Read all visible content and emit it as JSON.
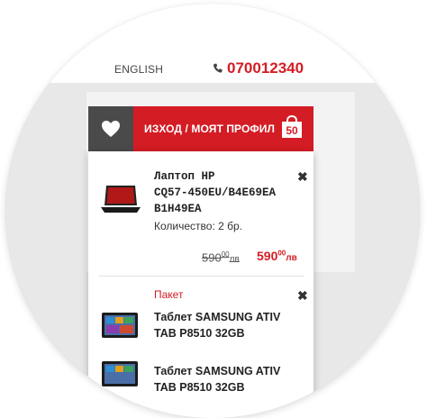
{
  "topbar": {
    "language": "ENGLISH",
    "phone": "070012340",
    "phone_icon": "phone-icon"
  },
  "header": {
    "wishlist_icon": "heart-icon",
    "profile_label": "ИЗХОД / МОЯТ ПРОФИЛ",
    "cart_icon": "shopping-bag-icon",
    "cart_count": "50",
    "accent": "#d41c24"
  },
  "cart": {
    "items": [
      {
        "name_line1": "Лаптоп HP",
        "name_line2": "CQ57-450EU/B4E69EA",
        "name_line3": "B1H49EA",
        "quantity": "Количество: 2 бр.",
        "old_price_main": "590",
        "old_price_cents": "00",
        "old_price_currency": "лв",
        "new_price_main": "590",
        "new_price_cents": "00",
        "new_price_currency": "лв",
        "remove": "✖"
      },
      {
        "tag": "Пакет",
        "name_line1": "Таблет SAMSUNG ATIV",
        "name_line2": "TAB P8510 32GB",
        "remove": "✖"
      },
      {
        "name_line1": "Таблет SAMSUNG ATIV",
        "name_line2": "TAB P8510 32GB"
      }
    ]
  }
}
